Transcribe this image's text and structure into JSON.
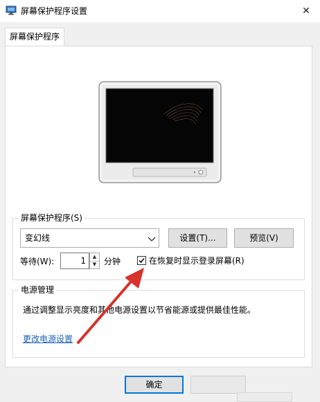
{
  "window": {
    "title": "屏幕保护程序设置",
    "close_glyph": "✕"
  },
  "tabs": [
    {
      "label": "屏幕保护程序",
      "selected": true
    }
  ],
  "screensaver_group": {
    "legend": "屏幕保护程序(S)",
    "selected": "变幻线",
    "settings_button": "设置(T)...",
    "preview_button": "预览(V)",
    "wait_label": "等待(W):",
    "wait_value": "1",
    "wait_unit": "分钟",
    "resume_checkbox_label": "在恢复时显示登录屏幕(R)",
    "resume_checked": true
  },
  "power_group": {
    "legend": "电源管理",
    "description": "通过调整显示亮度和其他电源设置以节省能源或提供最佳性能。",
    "link": "更改电源设置"
  },
  "footer": {
    "ok_button": "确定",
    "cancel_button": ""
  },
  "colors": {
    "annotation_arrow": "#d9312b",
    "link": "#1a5fb4",
    "focus_border": "#0078d7"
  }
}
